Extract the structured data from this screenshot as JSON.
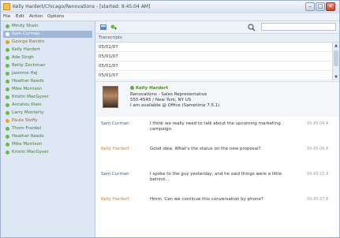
{
  "window": {
    "title": "Kelly Hardert/Chicago/Renovations - [started: 9:45:04 AM]",
    "minimize_glyph": "–",
    "maximize_glyph": "□",
    "close_glyph": "✕"
  },
  "menu": [
    "File",
    "Edit",
    "Action",
    "Options"
  ],
  "sidebar": {
    "contacts": [
      {
        "name": "Mindy Shain",
        "status": "online"
      },
      {
        "name": "Sam Curman",
        "status": "selected"
      },
      {
        "name": "George Bandro",
        "status": "away"
      },
      {
        "name": "Kelly Hardert",
        "status": "online"
      },
      {
        "name": "Ade Singh",
        "status": "online"
      },
      {
        "name": "Betty Zechman",
        "status": "online"
      },
      {
        "name": "Jasmine Haj",
        "status": "online"
      },
      {
        "name": "Heather Reeds",
        "status": "online"
      },
      {
        "name": "Mike Morrison",
        "status": "online"
      },
      {
        "name": "Kristin MacGyver",
        "status": "online"
      },
      {
        "name": "Annelou Klein",
        "status": "online"
      },
      {
        "name": "Larry Monterty",
        "status": "online"
      },
      {
        "name": "Paula Steffy",
        "status": "away"
      },
      {
        "name": "Thom Frankel",
        "status": "online"
      },
      {
        "name": "Heather Reeds",
        "status": "online"
      },
      {
        "name": "Mike Morrison",
        "status": "online"
      },
      {
        "name": "Kristin MacGyver",
        "status": "online"
      }
    ]
  },
  "toolbar": {
    "search_placeholder": ""
  },
  "transcript": {
    "header": "Transcripts",
    "rows": [
      "05/01/07",
      "05/01/07",
      "05/01/07",
      "05/01/07"
    ]
  },
  "card": {
    "name": "Kelly Hardert",
    "org": "Renovations - Sales Representative",
    "phone": "555-4545 / New York, NY US",
    "status_text": "I am available @ Office (Sametime 7.5.1)"
  },
  "messages": [
    {
      "sender": "Sam Curman",
      "sender_color": "#2f5fa8",
      "text": "I think we really need to talk about the upcoming marketing campaign.",
      "time": "09:45:04 A"
    },
    {
      "sender": "Kelly Hardert",
      "sender_color": "#e07b18",
      "text": "Good idea. What's the status on the new proposal?",
      "time": "09:45:06 A"
    },
    {
      "sender": "Sam Curman",
      "sender_color": "#2f5fa8",
      "text": "I spoke to the guy yesterday, and he said things were a little behind...",
      "time": "09:45:15 A"
    },
    {
      "sender": "Kelly Hardert",
      "sender_color": "#e07b18",
      "text": "Hmm. Can we continue this conversation by phone?",
      "time": "09:45:27 A"
    }
  ],
  "colors": {
    "online": "#6dbb3e",
    "away": "#e9a31b"
  }
}
